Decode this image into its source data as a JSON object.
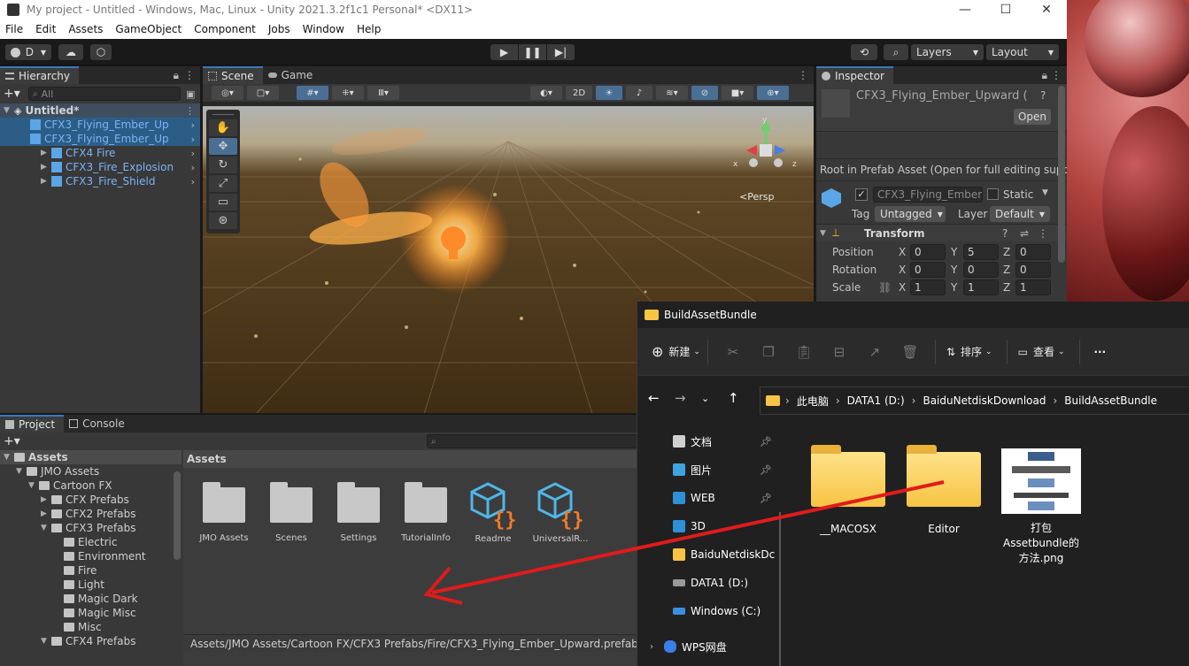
{
  "window": {
    "title": "My project - Untitled - Windows, Mac, Linux - Unity 2021.3.2f1c1 Personal* <DX11>",
    "controls": {
      "minimize": "—",
      "maximize": "☐",
      "close": "✕"
    }
  },
  "menu": [
    "File",
    "Edit",
    "Assets",
    "GameObject",
    "Component",
    "Jobs",
    "Window",
    "Help"
  ],
  "toolbar": {
    "account": "D",
    "layers": "Layers",
    "layout": "Layout"
  },
  "hierarchy": {
    "tab": "Hierarchy",
    "search_placeholder": "All",
    "scene": "Untitled*",
    "items": [
      "CFX3_Flying_Ember_Up",
      "CFX3_Flying_Ember_Up",
      "CFX4 Fire",
      "CFX3_Fire_Explosion",
      "CFX3_Fire_Shield"
    ]
  },
  "scene": {
    "tabs": [
      "Scene",
      "Game"
    ],
    "mode_2d": "2D",
    "persp": "<Persp",
    "gizmo_axes": {
      "x": "x",
      "y": "y",
      "z": "z"
    }
  },
  "inspector": {
    "tab": "Inspector",
    "asset_name": "CFX3_Flying_Ember_Upward (",
    "open_button": "Open",
    "root_note": "Root in Prefab Asset (Open for full editing suppo",
    "object_name": "CFX3_Flying_Ember_",
    "static_label": "Static",
    "tag_label": "Tag",
    "tag_value": "Untagged",
    "layer_label": "Layer",
    "layer_value": "Default",
    "component": "Transform",
    "rows": [
      {
        "label": "Position",
        "x": "0",
        "y": "5",
        "z": "0"
      },
      {
        "label": "Rotation",
        "x": "0",
        "y": "0",
        "z": "0"
      },
      {
        "label": "Scale",
        "x": "1",
        "y": "1",
        "z": "1"
      }
    ],
    "axis": {
      "x": "X",
      "y": "Y",
      "z": "Z"
    }
  },
  "project": {
    "tabs": [
      "Project",
      "Console"
    ],
    "tree": [
      {
        "label": "Assets",
        "depth": 0,
        "open": true,
        "type": "folder"
      },
      {
        "label": "JMO Assets",
        "depth": 1,
        "open": true,
        "type": "folder"
      },
      {
        "label": "Cartoon FX",
        "depth": 2,
        "open": true,
        "type": "folder"
      },
      {
        "label": "CFX Prefabs",
        "depth": 3,
        "open": false,
        "type": "folder"
      },
      {
        "label": "CFX2 Prefabs",
        "depth": 3,
        "open": false,
        "type": "folder"
      },
      {
        "label": "CFX3 Prefabs",
        "depth": 3,
        "open": true,
        "type": "folder"
      },
      {
        "label": "Electric",
        "depth": 4,
        "open": null,
        "type": "folder"
      },
      {
        "label": "Environment",
        "depth": 4,
        "open": null,
        "type": "folder"
      },
      {
        "label": "Fire",
        "depth": 4,
        "open": null,
        "type": "folder"
      },
      {
        "label": "Light",
        "depth": 4,
        "open": null,
        "type": "folder"
      },
      {
        "label": "Magic Dark",
        "depth": 4,
        "open": null,
        "type": "folder"
      },
      {
        "label": "Magic Misc",
        "depth": 4,
        "open": null,
        "type": "folder"
      },
      {
        "label": "Misc",
        "depth": 4,
        "open": null,
        "type": "folder"
      },
      {
        "label": "CFX4 Prefabs",
        "depth": 3,
        "open": true,
        "type": "folder"
      }
    ],
    "grid_header": "Assets",
    "assets": [
      "JMO Assets",
      "Scenes",
      "Settings",
      "TutorialInfo",
      "Readme",
      "UniversalR..."
    ],
    "footer_path": "Assets/JMO Assets/Cartoon FX/CFX3 Prefabs/Fire/CFX3_Flying_Ember_Upward.prefab"
  },
  "explorer": {
    "title": "BuildAssetBundle",
    "commands": {
      "new": "新建",
      "sort": "排序",
      "view": "查看",
      "more": "···"
    },
    "path": [
      "此电脑",
      "DATA1 (D:)",
      "BaiduNetdiskDownload",
      "BuildAssetBundle"
    ],
    "nav": [
      {
        "label": "文档",
        "icon": "document-icon",
        "pinned": true
      },
      {
        "label": "图片",
        "icon": "picture-icon",
        "pinned": true
      },
      {
        "label": "WEB",
        "icon": "monitor-icon",
        "pinned": true
      },
      {
        "label": "3D",
        "icon": "monitor-icon",
        "pinned": false
      },
      {
        "label": "BaiduNetdiskDc",
        "icon": "folder-icon",
        "pinned": false
      },
      {
        "label": "DATA1 (D:)",
        "icon": "drive-icon",
        "pinned": false
      },
      {
        "label": "Windows (C:)",
        "icon": "windows-drive-icon",
        "pinned": false
      },
      {
        "label": "WPS网盘",
        "icon": "cloud-icon",
        "pinned": false
      }
    ],
    "files": [
      {
        "name": "__MACOSX",
        "type": "folder"
      },
      {
        "name": "Editor",
        "type": "folder"
      },
      {
        "name": "打包\nAssetbundle的\n方法.png",
        "type": "image"
      }
    ]
  },
  "colors": {
    "annotation_arrow": "#e01b1b",
    "selection": "#2c5d87",
    "accent": "#3a79bb"
  }
}
